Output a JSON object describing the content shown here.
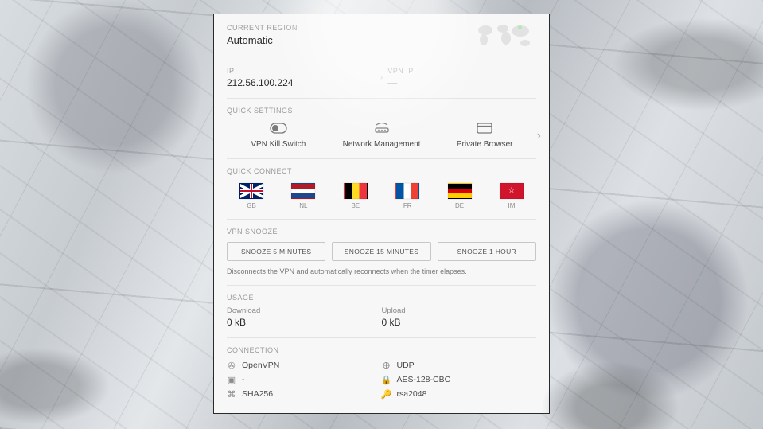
{
  "region": {
    "label": "CURRENT REGION",
    "value": "Automatic"
  },
  "ip": {
    "label": "IP",
    "value": "212.56.100.224"
  },
  "vpn_ip": {
    "label": "VPN IP",
    "value": "—"
  },
  "quick_settings": {
    "label": "QUICK SETTINGS",
    "items": [
      {
        "name": "kill-switch",
        "label": "VPN Kill Switch"
      },
      {
        "name": "network-management",
        "label": "Network Management"
      },
      {
        "name": "private-browser",
        "label": "Private Browser"
      }
    ]
  },
  "quick_connect": {
    "label": "QUICK CONNECT",
    "items": [
      {
        "code": "GB"
      },
      {
        "code": "NL"
      },
      {
        "code": "BE"
      },
      {
        "code": "FR"
      },
      {
        "code": "DE"
      },
      {
        "code": "IM"
      }
    ]
  },
  "snooze": {
    "label": "VPN SNOOZE",
    "buttons": [
      "SNOOZE 5 MINUTES",
      "SNOOZE 15 MINUTES",
      "SNOOZE 1 HOUR"
    ],
    "note": "Disconnects the VPN and automatically reconnects when the timer elapses."
  },
  "usage": {
    "label": "USAGE",
    "download_label": "Download",
    "download_value": "0 kB",
    "upload_label": "Upload",
    "upload_value": "0 kB"
  },
  "connection": {
    "label": "CONNECTION",
    "items": [
      {
        "icon": "plug-icon",
        "value": "OpenVPN"
      },
      {
        "icon": "globe-icon",
        "value": "UDP"
      },
      {
        "icon": "port-icon",
        "value": "-"
      },
      {
        "icon": "lock-icon",
        "value": "AES-128-CBC"
      },
      {
        "icon": "hash-icon",
        "value": "SHA256"
      },
      {
        "icon": "key-icon",
        "value": "rsa2048"
      }
    ]
  }
}
